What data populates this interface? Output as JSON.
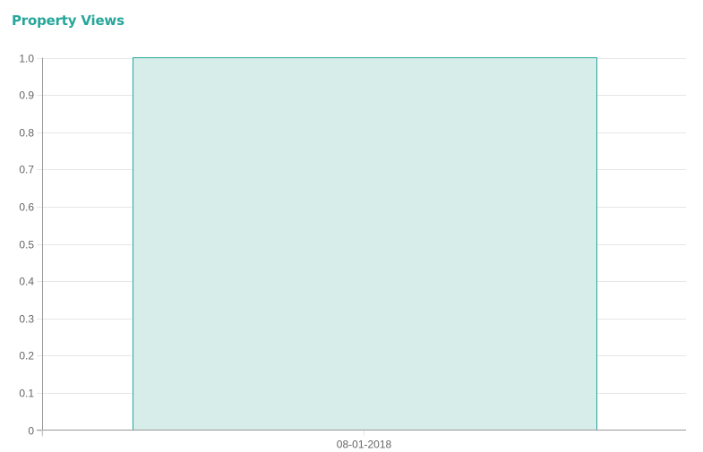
{
  "chart_data": {
    "type": "bar",
    "title": "Property Views",
    "categories": [
      "08-01-2018"
    ],
    "series": [
      {
        "values": [
          1
        ]
      }
    ],
    "ylim": [
      0,
      1
    ],
    "yticks": [
      "0",
      "0.1",
      "0.2",
      "0.3",
      "0.4",
      "0.5",
      "0.6",
      "0.7",
      "0.8",
      "0.9",
      "1.0"
    ],
    "grid": true,
    "legend": "none",
    "colors": {
      "title": "#26a69a",
      "bar_fill": "#d7ede9",
      "bar_stroke": "#26a69a",
      "grid": "#e6e6e6",
      "axis": "#999999",
      "tick_text": "#666666"
    }
  }
}
